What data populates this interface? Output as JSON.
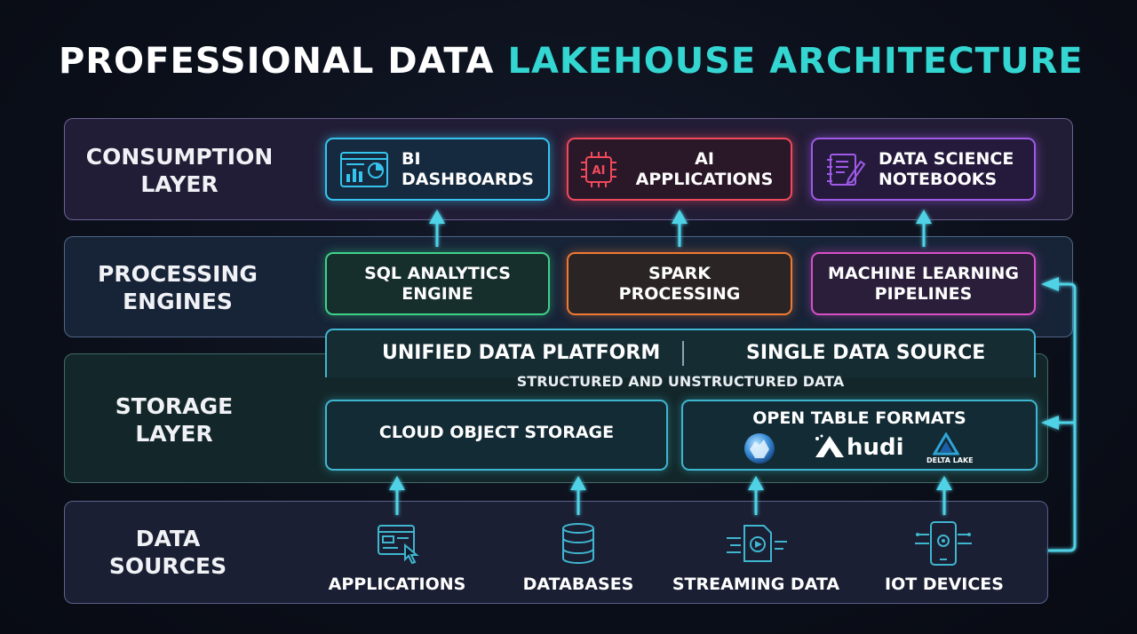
{
  "title": {
    "part1": "PROFESSIONAL DATA",
    "part2": "LAKEHOUSE ARCHITECTURE"
  },
  "layers": {
    "consumption": {
      "line1": "CONSUMPTION",
      "line2": "LAYER"
    },
    "processing": {
      "line1": "PROCESSING",
      "line2": "ENGINES"
    },
    "storage": {
      "line1": "STORAGE",
      "line2": "LAYER"
    },
    "sources": {
      "line1": "DATA",
      "line2": "SOURCES"
    }
  },
  "consumption": {
    "bi": {
      "line1": "BI",
      "line2": "DASHBOARDS"
    },
    "ai": {
      "line1": "AI",
      "line2": "APPLICATIONS",
      "icon_text": "AI"
    },
    "ds": {
      "line1": "DATA SCIENCE",
      "line2": "NOTEBOOKS"
    }
  },
  "processing": {
    "sql": {
      "line1": "SQL ANALYTICS",
      "line2": "ENGINE"
    },
    "spark": {
      "line1": "SPARK",
      "line2": "PROCESSING"
    },
    "ml": {
      "line1": "MACHINE LEARNING",
      "line2": "PIPELINES"
    }
  },
  "storage": {
    "unified_left": "UNIFIED DATA PLATFORM",
    "unified_right": "SINGLE DATA SOURCE",
    "structured": "STRUCTURED AND UNSTRUCTURED DATA",
    "cloud": "CLOUD OBJECT STORAGE",
    "otf": "OPEN TABLE FORMATS",
    "hudi": "hudi",
    "delta": "DELTA LAKE"
  },
  "sources": {
    "applications": "APPLICATIONS",
    "databases": "DATABASES",
    "streaming": "STREAMING DATA",
    "iot": "IOT DEVICES"
  },
  "colors": {
    "accent": "#34d6d2",
    "bi": "#36c4ef",
    "ai": "#ef4a5c",
    "ds": "#9f5ae8",
    "sql": "#3ed18a",
    "spark": "#ef7a33",
    "ml": "#d84fc8",
    "storage": "#3fb6cf"
  }
}
